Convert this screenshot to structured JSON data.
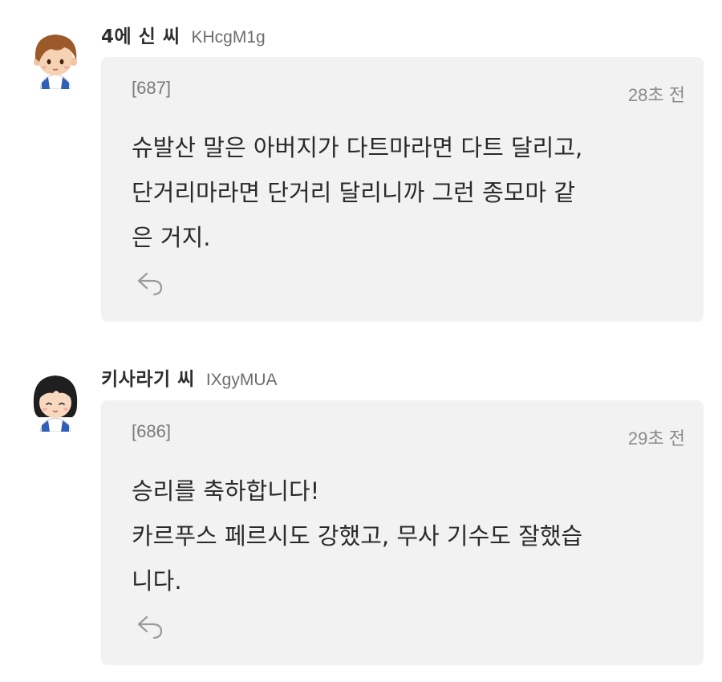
{
  "comments": [
    {
      "nickname": "4에 신 씨",
      "user_id": "KHcgM1g",
      "index": "[687]",
      "time": "28초 전",
      "lines": [
        "슈발산 말은 아버지가 다트마라면 다트 달리고,",
        "단거리마라면 단거리 달리니까 그런 종모마 같",
        "은 거지."
      ],
      "avatar_icon": "boy-avatar-icon",
      "reply_icon": "reply-arrow-icon"
    },
    {
      "nickname": "키사라기 씨",
      "user_id": "IXgyMUA",
      "index": "[686]",
      "time": "29초 전",
      "lines": [
        "승리를 축하합니다!",
        "카르푸스 페르시도 강했고, 무사 기수도 잘했습",
        "니다."
      ],
      "avatar_icon": "girl-avatar-icon",
      "reply_icon": "reply-arrow-icon"
    }
  ],
  "colors": {
    "bubble_bg": "#f2f2f2",
    "nickname": "#2e2e2e",
    "meta": "#7a7a7a",
    "body": "#2a2a2a"
  }
}
